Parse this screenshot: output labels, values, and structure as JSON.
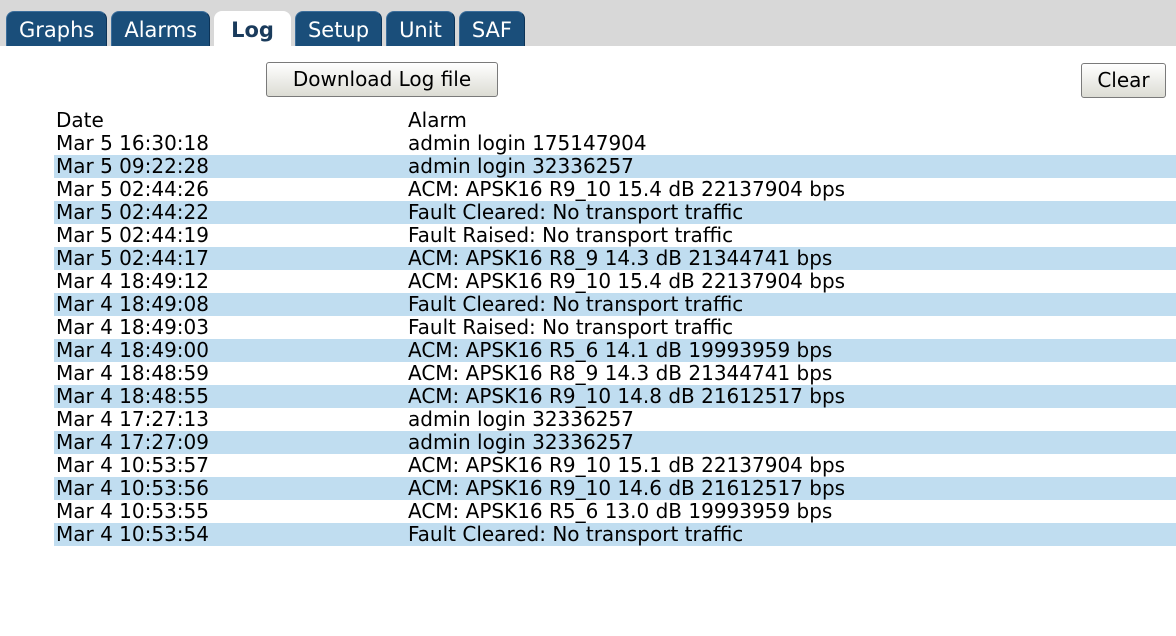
{
  "tabs": [
    {
      "label": "Graphs"
    },
    {
      "label": "Alarms"
    },
    {
      "label": "Log"
    },
    {
      "label": "Setup"
    },
    {
      "label": "Unit"
    },
    {
      "label": "SAF"
    }
  ],
  "active_tab": "Log",
  "buttons": {
    "download_label": "Download Log file",
    "clear_label": "Clear"
  },
  "table": {
    "columns": [
      "Date",
      "Alarm"
    ],
    "rows": [
      {
        "date": "Mar 5 16:30:18",
        "alarm": "admin login 175147904"
      },
      {
        "date": "Mar 5 09:22:28",
        "alarm": "admin login 32336257"
      },
      {
        "date": "Mar 5 02:44:26",
        "alarm": "ACM: APSK16 R9_10 15.4 dB 22137904 bps"
      },
      {
        "date": "Mar 5 02:44:22",
        "alarm": "Fault Cleared: No transport traffic"
      },
      {
        "date": "Mar 5 02:44:19",
        "alarm": "Fault Raised: No transport traffic"
      },
      {
        "date": "Mar 5 02:44:17",
        "alarm": "ACM: APSK16 R8_9 14.3 dB 21344741 bps"
      },
      {
        "date": "Mar 4 18:49:12",
        "alarm": "ACM: APSK16 R9_10 15.4 dB 22137904 bps"
      },
      {
        "date": "Mar 4 18:49:08",
        "alarm": "Fault Cleared: No transport traffic"
      },
      {
        "date": "Mar 4 18:49:03",
        "alarm": "Fault Raised: No transport traffic"
      },
      {
        "date": "Mar 4 18:49:00",
        "alarm": "ACM: APSK16 R5_6 14.1 dB 19993959 bps"
      },
      {
        "date": "Mar 4 18:48:59",
        "alarm": "ACM: APSK16 R8_9 14.3 dB 21344741 bps"
      },
      {
        "date": "Mar 4 18:48:55",
        "alarm": "ACM: APSK16 R9_10 14.8 dB 21612517 bps"
      },
      {
        "date": "Mar 4 17:27:13",
        "alarm": "admin login 32336257"
      },
      {
        "date": "Mar 4 17:27:09",
        "alarm": "admin login 32336257"
      },
      {
        "date": "Mar 4 10:53:57",
        "alarm": "ACM: APSK16 R9_10 15.1 dB 22137904 bps"
      },
      {
        "date": "Mar 4 10:53:56",
        "alarm": "ACM: APSK16 R9_10 14.6 dB 21612517 bps"
      },
      {
        "date": "Mar 4 10:53:55",
        "alarm": "ACM: APSK16 R5_6 13.0 dB 19993959 bps"
      },
      {
        "date": "Mar 4 10:53:54",
        "alarm": "Fault Cleared: No transport traffic"
      }
    ]
  },
  "colors": {
    "tab_background": "#1a4e7a",
    "tab_bar": "#d8d8d8",
    "row_stripe": "#c0ddf0"
  }
}
